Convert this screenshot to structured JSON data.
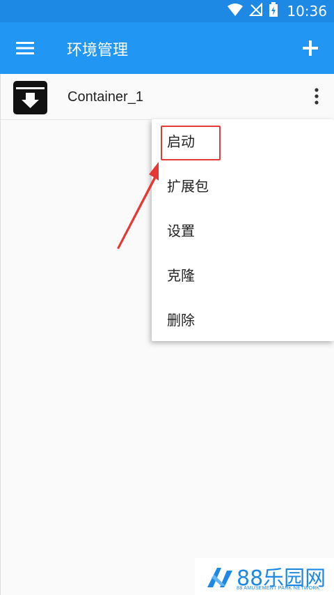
{
  "status_bar": {
    "time": "10:36"
  },
  "app_bar": {
    "title": "环境管理"
  },
  "containers": [
    {
      "name": "Container_1"
    }
  ],
  "popup_menu": {
    "items": [
      {
        "label": "启动"
      },
      {
        "label": "扩展包"
      },
      {
        "label": "设置"
      },
      {
        "label": "克隆"
      },
      {
        "label": "删除"
      }
    ]
  },
  "watermark": {
    "brand": "88乐园网",
    "sub": "88 AMUSEMENT PARK NETWORK"
  },
  "colors": {
    "status_bar": "#1e88e5",
    "app_bar": "#2196f3",
    "annotation": "#e53935"
  }
}
